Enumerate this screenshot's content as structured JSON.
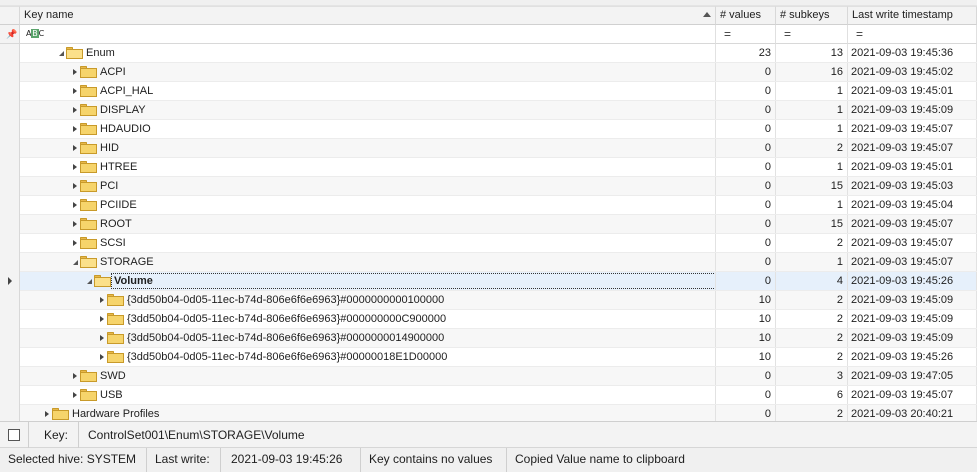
{
  "columns": {
    "key_name": "Key name",
    "values": "# values",
    "subkeys": "# subkeys",
    "timestamp": "Last write timestamp"
  },
  "filter": {
    "pin_icon": "pin-icon",
    "text_icon": "abc-filter-icon",
    "abc_a": "A",
    "abc_b": "B",
    "abc_c": "C",
    "values_op": "=",
    "subkeys_op": "=",
    "timestamp_op": "="
  },
  "rows": [
    {
      "name": "Enum",
      "values": "23",
      "subkeys": "13",
      "timestamp": "2021-09-03 19:45:36",
      "level": 0,
      "expanded": true
    },
    {
      "name": "ACPI",
      "values": "0",
      "subkeys": "16",
      "timestamp": "2021-09-03 19:45:02",
      "level": 1,
      "expanded": false
    },
    {
      "name": "ACPI_HAL",
      "values": "0",
      "subkeys": "1",
      "timestamp": "2021-09-03 19:45:01",
      "level": 1,
      "expanded": false
    },
    {
      "name": "DISPLAY",
      "values": "0",
      "subkeys": "1",
      "timestamp": "2021-09-03 19:45:09",
      "level": 1,
      "expanded": false
    },
    {
      "name": "HDAUDIO",
      "values": "0",
      "subkeys": "1",
      "timestamp": "2021-09-03 19:45:07",
      "level": 1,
      "expanded": false
    },
    {
      "name": "HID",
      "values": "0",
      "subkeys": "2",
      "timestamp": "2021-09-03 19:45:07",
      "level": 1,
      "expanded": false
    },
    {
      "name": "HTREE",
      "values": "0",
      "subkeys": "1",
      "timestamp": "2021-09-03 19:45:01",
      "level": 1,
      "expanded": false
    },
    {
      "name": "PCI",
      "values": "0",
      "subkeys": "15",
      "timestamp": "2021-09-03 19:45:03",
      "level": 1,
      "expanded": false
    },
    {
      "name": "PCIIDE",
      "values": "0",
      "subkeys": "1",
      "timestamp": "2021-09-03 19:45:04",
      "level": 1,
      "expanded": false
    },
    {
      "name": "ROOT",
      "values": "0",
      "subkeys": "15",
      "timestamp": "2021-09-03 19:45:07",
      "level": 1,
      "expanded": false
    },
    {
      "name": "SCSI",
      "values": "0",
      "subkeys": "2",
      "timestamp": "2021-09-03 19:45:07",
      "level": 1,
      "expanded": false
    },
    {
      "name": "STORAGE",
      "values": "0",
      "subkeys": "1",
      "timestamp": "2021-09-03 19:45:07",
      "level": 1,
      "expanded": true
    },
    {
      "name": "Volume",
      "values": "0",
      "subkeys": "4",
      "timestamp": "2021-09-03 19:45:26",
      "level": 2,
      "expanded": true,
      "selected": true
    },
    {
      "name": "{3dd50b04-0d05-11ec-b74d-806e6f6e6963}#0000000000100000",
      "values": "10",
      "subkeys": "2",
      "timestamp": "2021-09-03 19:45:09",
      "level": 3,
      "expanded": false
    },
    {
      "name": "{3dd50b04-0d05-11ec-b74d-806e6f6e6963}#000000000C900000",
      "values": "10",
      "subkeys": "2",
      "timestamp": "2021-09-03 19:45:09",
      "level": 3,
      "expanded": false
    },
    {
      "name": "{3dd50b04-0d05-11ec-b74d-806e6f6e6963}#0000000014900000",
      "values": "10",
      "subkeys": "2",
      "timestamp": "2021-09-03 19:45:09",
      "level": 3,
      "expanded": false
    },
    {
      "name": "{3dd50b04-0d05-11ec-b74d-806e6f6e6963}#00000018E1D00000",
      "values": "10",
      "subkeys": "2",
      "timestamp": "2021-09-03 19:45:26",
      "level": 3,
      "expanded": false
    },
    {
      "name": "SWD",
      "values": "0",
      "subkeys": "3",
      "timestamp": "2021-09-03 19:47:05",
      "level": 1,
      "expanded": false
    },
    {
      "name": "USB",
      "values": "0",
      "subkeys": "6",
      "timestamp": "2021-09-03 19:45:07",
      "level": 1,
      "expanded": false
    },
    {
      "name": "Hardware Profiles",
      "values": "0",
      "subkeys": "2",
      "timestamp": "2021-09-03 20:40:21",
      "level": -1,
      "expanded": false
    }
  ],
  "keybar": {
    "label": "Key:",
    "path": "ControlSet001\\Enum\\STORAGE\\Volume"
  },
  "status": {
    "hive": "Selected hive: SYSTEM",
    "last_write_label": "Last write:",
    "last_write_value": "2021-09-03 19:45:26",
    "message1": "Key contains no values",
    "message2": "Copied Value name to clipboard"
  },
  "colors": {
    "selected_row": "#e6f0fb",
    "folder": "#f6d46b"
  }
}
